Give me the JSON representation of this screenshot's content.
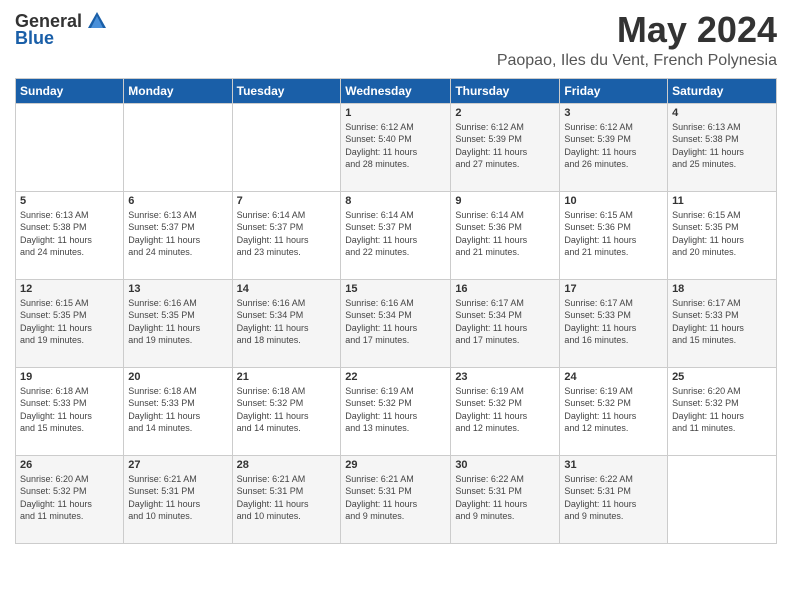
{
  "logo": {
    "general": "General",
    "blue": "Blue"
  },
  "title": "May 2024",
  "location": "Paopao, Iles du Vent, French Polynesia",
  "days_of_week": [
    "Sunday",
    "Monday",
    "Tuesday",
    "Wednesday",
    "Thursday",
    "Friday",
    "Saturday"
  ],
  "weeks": [
    [
      {
        "day": "",
        "info": ""
      },
      {
        "day": "",
        "info": ""
      },
      {
        "day": "",
        "info": ""
      },
      {
        "day": "1",
        "info": "Sunrise: 6:12 AM\nSunset: 5:40 PM\nDaylight: 11 hours\nand 28 minutes."
      },
      {
        "day": "2",
        "info": "Sunrise: 6:12 AM\nSunset: 5:39 PM\nDaylight: 11 hours\nand 27 minutes."
      },
      {
        "day": "3",
        "info": "Sunrise: 6:12 AM\nSunset: 5:39 PM\nDaylight: 11 hours\nand 26 minutes."
      },
      {
        "day": "4",
        "info": "Sunrise: 6:13 AM\nSunset: 5:38 PM\nDaylight: 11 hours\nand 25 minutes."
      }
    ],
    [
      {
        "day": "5",
        "info": "Sunrise: 6:13 AM\nSunset: 5:38 PM\nDaylight: 11 hours\nand 24 minutes."
      },
      {
        "day": "6",
        "info": "Sunrise: 6:13 AM\nSunset: 5:37 PM\nDaylight: 11 hours\nand 24 minutes."
      },
      {
        "day": "7",
        "info": "Sunrise: 6:14 AM\nSunset: 5:37 PM\nDaylight: 11 hours\nand 23 minutes."
      },
      {
        "day": "8",
        "info": "Sunrise: 6:14 AM\nSunset: 5:37 PM\nDaylight: 11 hours\nand 22 minutes."
      },
      {
        "day": "9",
        "info": "Sunrise: 6:14 AM\nSunset: 5:36 PM\nDaylight: 11 hours\nand 21 minutes."
      },
      {
        "day": "10",
        "info": "Sunrise: 6:15 AM\nSunset: 5:36 PM\nDaylight: 11 hours\nand 21 minutes."
      },
      {
        "day": "11",
        "info": "Sunrise: 6:15 AM\nSunset: 5:35 PM\nDaylight: 11 hours\nand 20 minutes."
      }
    ],
    [
      {
        "day": "12",
        "info": "Sunrise: 6:15 AM\nSunset: 5:35 PM\nDaylight: 11 hours\nand 19 minutes."
      },
      {
        "day": "13",
        "info": "Sunrise: 6:16 AM\nSunset: 5:35 PM\nDaylight: 11 hours\nand 19 minutes."
      },
      {
        "day": "14",
        "info": "Sunrise: 6:16 AM\nSunset: 5:34 PM\nDaylight: 11 hours\nand 18 minutes."
      },
      {
        "day": "15",
        "info": "Sunrise: 6:16 AM\nSunset: 5:34 PM\nDaylight: 11 hours\nand 17 minutes."
      },
      {
        "day": "16",
        "info": "Sunrise: 6:17 AM\nSunset: 5:34 PM\nDaylight: 11 hours\nand 17 minutes."
      },
      {
        "day": "17",
        "info": "Sunrise: 6:17 AM\nSunset: 5:33 PM\nDaylight: 11 hours\nand 16 minutes."
      },
      {
        "day": "18",
        "info": "Sunrise: 6:17 AM\nSunset: 5:33 PM\nDaylight: 11 hours\nand 15 minutes."
      }
    ],
    [
      {
        "day": "19",
        "info": "Sunrise: 6:18 AM\nSunset: 5:33 PM\nDaylight: 11 hours\nand 15 minutes."
      },
      {
        "day": "20",
        "info": "Sunrise: 6:18 AM\nSunset: 5:33 PM\nDaylight: 11 hours\nand 14 minutes."
      },
      {
        "day": "21",
        "info": "Sunrise: 6:18 AM\nSunset: 5:32 PM\nDaylight: 11 hours\nand 14 minutes."
      },
      {
        "day": "22",
        "info": "Sunrise: 6:19 AM\nSunset: 5:32 PM\nDaylight: 11 hours\nand 13 minutes."
      },
      {
        "day": "23",
        "info": "Sunrise: 6:19 AM\nSunset: 5:32 PM\nDaylight: 11 hours\nand 12 minutes."
      },
      {
        "day": "24",
        "info": "Sunrise: 6:19 AM\nSunset: 5:32 PM\nDaylight: 11 hours\nand 12 minutes."
      },
      {
        "day": "25",
        "info": "Sunrise: 6:20 AM\nSunset: 5:32 PM\nDaylight: 11 hours\nand 11 minutes."
      }
    ],
    [
      {
        "day": "26",
        "info": "Sunrise: 6:20 AM\nSunset: 5:32 PM\nDaylight: 11 hours\nand 11 minutes."
      },
      {
        "day": "27",
        "info": "Sunrise: 6:21 AM\nSunset: 5:31 PM\nDaylight: 11 hours\nand 10 minutes."
      },
      {
        "day": "28",
        "info": "Sunrise: 6:21 AM\nSunset: 5:31 PM\nDaylight: 11 hours\nand 10 minutes."
      },
      {
        "day": "29",
        "info": "Sunrise: 6:21 AM\nSunset: 5:31 PM\nDaylight: 11 hours\nand 9 minutes."
      },
      {
        "day": "30",
        "info": "Sunrise: 6:22 AM\nSunset: 5:31 PM\nDaylight: 11 hours\nand 9 minutes."
      },
      {
        "day": "31",
        "info": "Sunrise: 6:22 AM\nSunset: 5:31 PM\nDaylight: 11 hours\nand 9 minutes."
      },
      {
        "day": "",
        "info": ""
      }
    ]
  ]
}
